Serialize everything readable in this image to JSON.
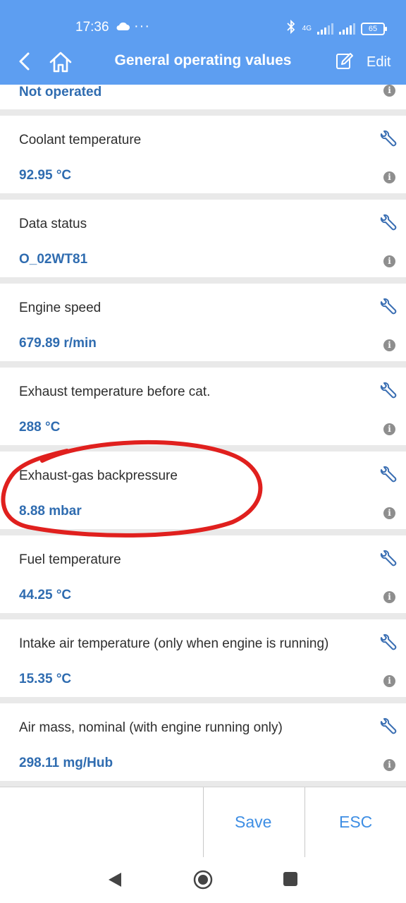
{
  "status_bar": {
    "time": "17:36",
    "dots": "···",
    "network": "4G",
    "battery": "65"
  },
  "app_bar": {
    "title": "General operating values",
    "edit_label": "Edit"
  },
  "partial_row": {
    "value": "Not operated"
  },
  "rows": [
    {
      "label": "Coolant temperature",
      "value": "92.95 °C"
    },
    {
      "label": "Data status",
      "value": "O_02WT81"
    },
    {
      "label": "Engine speed",
      "value": "679.89 r/min"
    },
    {
      "label": "Exhaust temperature before cat.",
      "value": "288 °C"
    },
    {
      "label": "Exhaust-gas backpressure",
      "value": "8.88 mbar"
    },
    {
      "label": "Fuel temperature",
      "value": "44.25 °C"
    },
    {
      "label": "Intake air temperature (only when engine is running)",
      "value": "15.35 °C"
    },
    {
      "label": "Air mass, nominal (with engine running only)",
      "value": "298.11 mg/Hub"
    }
  ],
  "info_glyph": "i",
  "actions": {
    "save": "Save",
    "esc": "ESC"
  },
  "colors": {
    "header": "#5d9ef1",
    "value_text": "#2f6cb0",
    "action_text": "#3e8ee4",
    "annotation": "#e0201e"
  }
}
